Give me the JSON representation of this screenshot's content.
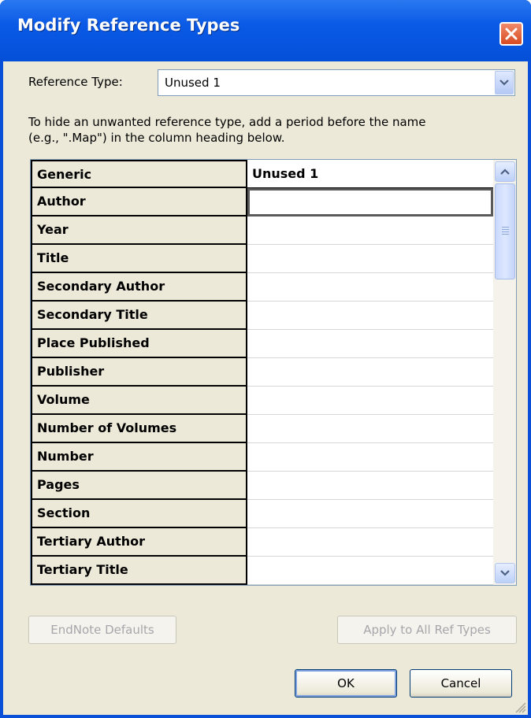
{
  "window": {
    "title": "Modify Reference Types"
  },
  "reference_type": {
    "label": "Reference Type:",
    "value": "Unused 1"
  },
  "instructions": {
    "line1": "To hide an unwanted reference type, add a period before the name",
    "line2": "(e.g., \".Map\") in the column heading below."
  },
  "table": {
    "rows": [
      {
        "field": "Generic",
        "value": "Unused 1"
      },
      {
        "field": "Author",
        "value": ""
      },
      {
        "field": "Year",
        "value": ""
      },
      {
        "field": "Title",
        "value": ""
      },
      {
        "field": "Secondary Author",
        "value": ""
      },
      {
        "field": "Secondary Title",
        "value": ""
      },
      {
        "field": "Place Published",
        "value": ""
      },
      {
        "field": "Publisher",
        "value": ""
      },
      {
        "field": "Volume",
        "value": ""
      },
      {
        "field": "Number of Volumes",
        "value": ""
      },
      {
        "field": "Number",
        "value": ""
      },
      {
        "field": "Pages",
        "value": ""
      },
      {
        "field": "Section",
        "value": ""
      },
      {
        "field": "Tertiary Author",
        "value": ""
      },
      {
        "field": "Tertiary Title",
        "value": ""
      }
    ]
  },
  "buttons": {
    "endnote_defaults": "EndNote Defaults",
    "apply_all": "Apply to All Ref Types",
    "ok": "OK",
    "cancel": "Cancel"
  },
  "icons": {
    "close": "close-icon",
    "dropdown": "chevron-down-icon",
    "scroll_up": "scroll-up-icon",
    "scroll_down": "scroll-down-icon",
    "resize": "resize-grip-icon"
  },
  "colors": {
    "titlebar": "#0550d8",
    "dialog_bg": "#ece9d8",
    "close_button": "#d84a20"
  }
}
